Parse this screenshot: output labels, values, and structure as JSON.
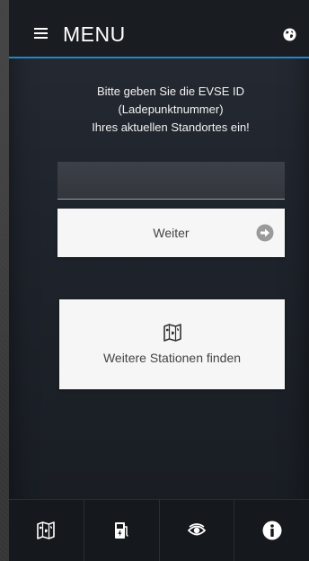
{
  "header": {
    "menu_label": "MENU",
    "menu_icon": "hamburger-icon",
    "language_icon": "globe-icon"
  },
  "main": {
    "instruction_lines": [
      "Bitte geben Sie die EVSE ID",
      "(Ladepunktnummer)",
      "Ihres aktuellen Standortes ein!"
    ],
    "evse_input": {
      "value": "",
      "placeholder": ""
    },
    "weiter_label": "Weiter",
    "weiter_icon": "arrow-right-circle-icon",
    "find_stations_label": "Weitere Stationen finden",
    "find_stations_icon": "map-icon"
  },
  "bottom_nav": {
    "items": [
      {
        "icon": "map-icon"
      },
      {
        "icon": "charging-station-icon"
      },
      {
        "icon": "eye-icon"
      },
      {
        "icon": "info-icon"
      }
    ]
  },
  "colors": {
    "accent": "#1e88c8",
    "header_bg": "#191c21",
    "button_bg": "#f6f6f6",
    "button_text": "#444444"
  }
}
